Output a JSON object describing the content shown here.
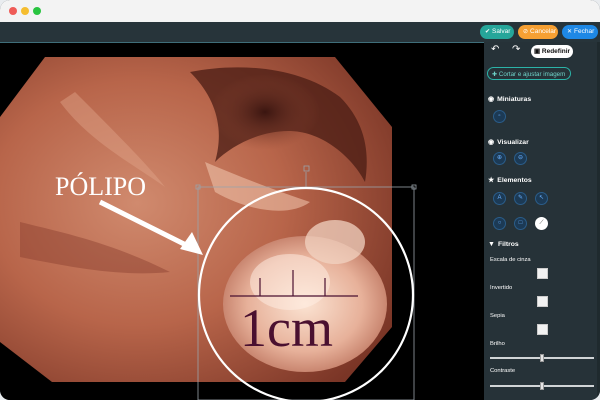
{
  "toolbar": {
    "save_label": "Salvar",
    "cancel_label": "Cancelar",
    "close_label": "Fechar"
  },
  "image": {
    "annotation_text": "PÓLIPO",
    "scale_text": "1cm"
  },
  "panel": {
    "undo_icon": "undo-icon",
    "redo_icon": "redo-icon",
    "reset_label": "Redefinir",
    "crop_label": "Cortar e ajustar imagem",
    "sections": {
      "thumbnails": "Miniaturas",
      "view": "Visualizar",
      "elements": "Elementos",
      "filters": "Filtros"
    },
    "filters": {
      "grayscale": "Escala de cinza",
      "inverted": "Invertido",
      "sepia": "Sepia",
      "brightness": "Brilho",
      "contrast": "Contraste",
      "brightness_level": 0.5,
      "contrast_level": 0.5
    }
  },
  "colors": {
    "save": "#26a69a",
    "cancel": "#f6a033",
    "close": "#1e88e5",
    "accent": "#2bb3a8"
  }
}
